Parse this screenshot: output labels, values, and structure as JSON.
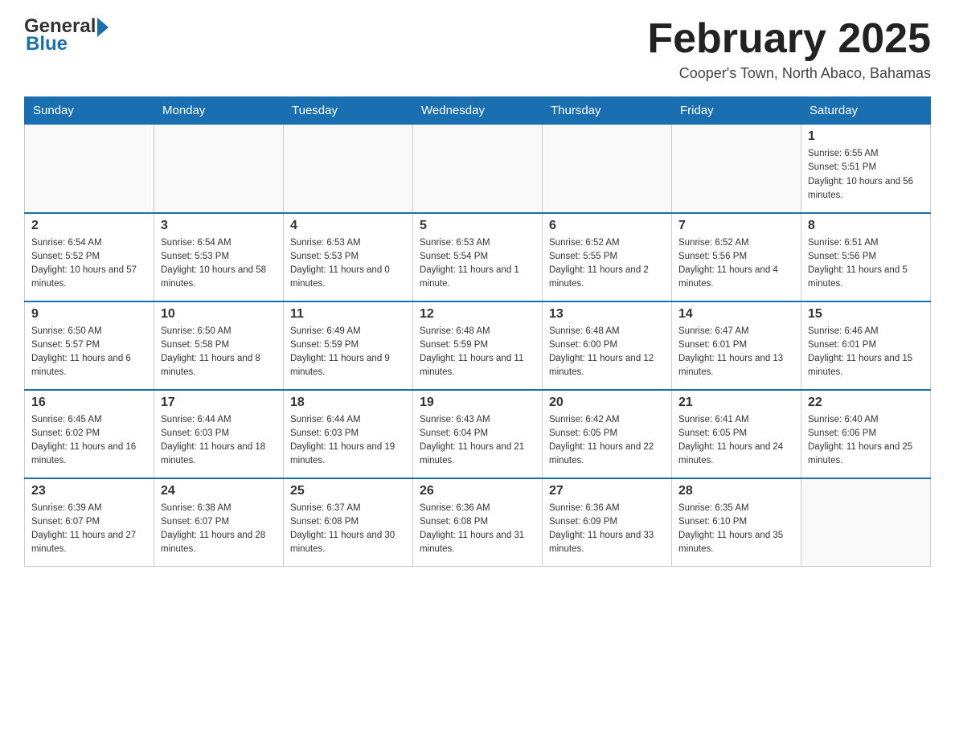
{
  "header": {
    "logo_general": "General",
    "logo_blue": "Blue",
    "month_title": "February 2025",
    "location": "Cooper's Town, North Abaco, Bahamas"
  },
  "days_of_week": [
    "Sunday",
    "Monday",
    "Tuesday",
    "Wednesday",
    "Thursday",
    "Friday",
    "Saturday"
  ],
  "weeks": [
    [
      {
        "day": "",
        "info": ""
      },
      {
        "day": "",
        "info": ""
      },
      {
        "day": "",
        "info": ""
      },
      {
        "day": "",
        "info": ""
      },
      {
        "day": "",
        "info": ""
      },
      {
        "day": "",
        "info": ""
      },
      {
        "day": "1",
        "info": "Sunrise: 6:55 AM\nSunset: 5:51 PM\nDaylight: 10 hours and 56 minutes."
      }
    ],
    [
      {
        "day": "2",
        "info": "Sunrise: 6:54 AM\nSunset: 5:52 PM\nDaylight: 10 hours and 57 minutes."
      },
      {
        "day": "3",
        "info": "Sunrise: 6:54 AM\nSunset: 5:53 PM\nDaylight: 10 hours and 58 minutes."
      },
      {
        "day": "4",
        "info": "Sunrise: 6:53 AM\nSunset: 5:53 PM\nDaylight: 11 hours and 0 minutes."
      },
      {
        "day": "5",
        "info": "Sunrise: 6:53 AM\nSunset: 5:54 PM\nDaylight: 11 hours and 1 minute."
      },
      {
        "day": "6",
        "info": "Sunrise: 6:52 AM\nSunset: 5:55 PM\nDaylight: 11 hours and 2 minutes."
      },
      {
        "day": "7",
        "info": "Sunrise: 6:52 AM\nSunset: 5:56 PM\nDaylight: 11 hours and 4 minutes."
      },
      {
        "day": "8",
        "info": "Sunrise: 6:51 AM\nSunset: 5:56 PM\nDaylight: 11 hours and 5 minutes."
      }
    ],
    [
      {
        "day": "9",
        "info": "Sunrise: 6:50 AM\nSunset: 5:57 PM\nDaylight: 11 hours and 6 minutes."
      },
      {
        "day": "10",
        "info": "Sunrise: 6:50 AM\nSunset: 5:58 PM\nDaylight: 11 hours and 8 minutes."
      },
      {
        "day": "11",
        "info": "Sunrise: 6:49 AM\nSunset: 5:59 PM\nDaylight: 11 hours and 9 minutes."
      },
      {
        "day": "12",
        "info": "Sunrise: 6:48 AM\nSunset: 5:59 PM\nDaylight: 11 hours and 11 minutes."
      },
      {
        "day": "13",
        "info": "Sunrise: 6:48 AM\nSunset: 6:00 PM\nDaylight: 11 hours and 12 minutes."
      },
      {
        "day": "14",
        "info": "Sunrise: 6:47 AM\nSunset: 6:01 PM\nDaylight: 11 hours and 13 minutes."
      },
      {
        "day": "15",
        "info": "Sunrise: 6:46 AM\nSunset: 6:01 PM\nDaylight: 11 hours and 15 minutes."
      }
    ],
    [
      {
        "day": "16",
        "info": "Sunrise: 6:45 AM\nSunset: 6:02 PM\nDaylight: 11 hours and 16 minutes."
      },
      {
        "day": "17",
        "info": "Sunrise: 6:44 AM\nSunset: 6:03 PM\nDaylight: 11 hours and 18 minutes."
      },
      {
        "day": "18",
        "info": "Sunrise: 6:44 AM\nSunset: 6:03 PM\nDaylight: 11 hours and 19 minutes."
      },
      {
        "day": "19",
        "info": "Sunrise: 6:43 AM\nSunset: 6:04 PM\nDaylight: 11 hours and 21 minutes."
      },
      {
        "day": "20",
        "info": "Sunrise: 6:42 AM\nSunset: 6:05 PM\nDaylight: 11 hours and 22 minutes."
      },
      {
        "day": "21",
        "info": "Sunrise: 6:41 AM\nSunset: 6:05 PM\nDaylight: 11 hours and 24 minutes."
      },
      {
        "day": "22",
        "info": "Sunrise: 6:40 AM\nSunset: 6:06 PM\nDaylight: 11 hours and 25 minutes."
      }
    ],
    [
      {
        "day": "23",
        "info": "Sunrise: 6:39 AM\nSunset: 6:07 PM\nDaylight: 11 hours and 27 minutes."
      },
      {
        "day": "24",
        "info": "Sunrise: 6:38 AM\nSunset: 6:07 PM\nDaylight: 11 hours and 28 minutes."
      },
      {
        "day": "25",
        "info": "Sunrise: 6:37 AM\nSunset: 6:08 PM\nDaylight: 11 hours and 30 minutes."
      },
      {
        "day": "26",
        "info": "Sunrise: 6:36 AM\nSunset: 6:08 PM\nDaylight: 11 hours and 31 minutes."
      },
      {
        "day": "27",
        "info": "Sunrise: 6:36 AM\nSunset: 6:09 PM\nDaylight: 11 hours and 33 minutes."
      },
      {
        "day": "28",
        "info": "Sunrise: 6:35 AM\nSunset: 6:10 PM\nDaylight: 11 hours and 35 minutes."
      },
      {
        "day": "",
        "info": ""
      }
    ]
  ]
}
